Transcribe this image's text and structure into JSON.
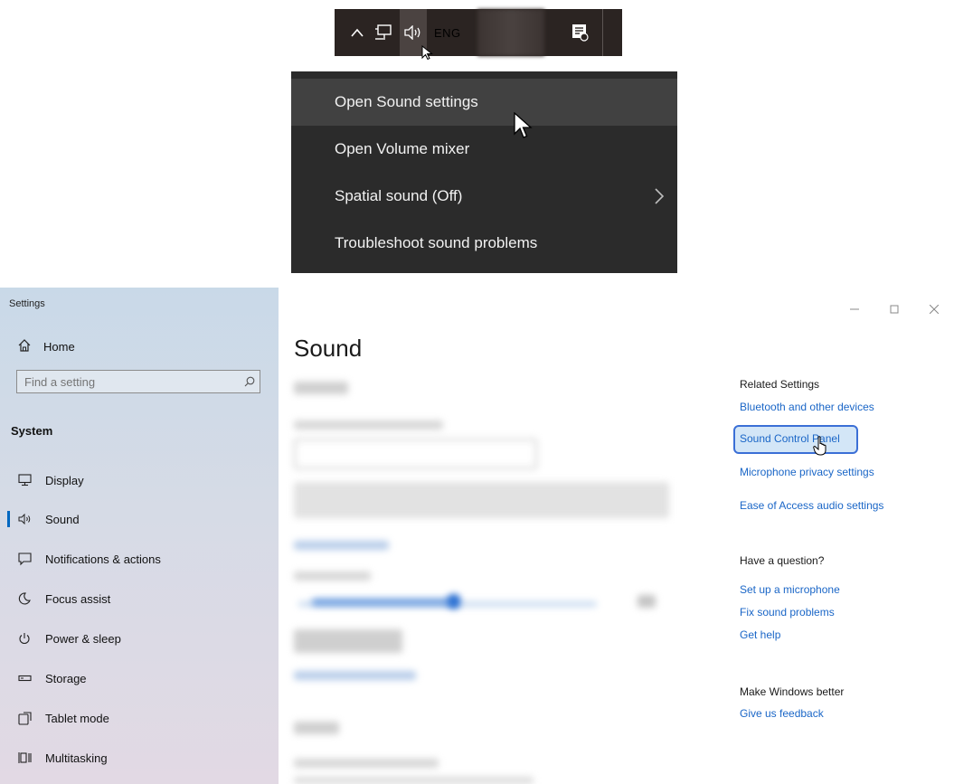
{
  "taskbar": {
    "language": "ENG",
    "icons": [
      "chevron-up-icon",
      "network-icon",
      "volume-icon",
      "notification-icon"
    ]
  },
  "context_menu": {
    "items": [
      {
        "label": "Open Sound settings",
        "hovered": true
      },
      {
        "label": "Open Volume mixer"
      },
      {
        "label": "Spatial sound (Off)",
        "has_submenu": true
      },
      {
        "label": "Troubleshoot sound problems"
      }
    ]
  },
  "settings": {
    "window_title": "Settings",
    "home_label": "Home",
    "search_placeholder": "Find a setting",
    "section_label": "System",
    "nav_items": [
      {
        "label": "Display",
        "icon": "display-icon"
      },
      {
        "label": "Sound",
        "icon": "sound-icon",
        "active": true
      },
      {
        "label": "Notifications & actions",
        "icon": "notifications-icon"
      },
      {
        "label": "Focus assist",
        "icon": "focus-assist-icon"
      },
      {
        "label": "Power & sleep",
        "icon": "power-icon"
      },
      {
        "label": "Storage",
        "icon": "storage-icon"
      },
      {
        "label": "Tablet mode",
        "icon": "tablet-icon"
      },
      {
        "label": "Multitasking",
        "icon": "multitasking-icon"
      }
    ],
    "page_title": "Sound",
    "related_settings": {
      "heading": "Related Settings",
      "links": [
        "Bluetooth and other devices",
        "Sound Control Panel",
        "Microphone privacy settings",
        "Ease of Access audio settings"
      ]
    },
    "question": {
      "heading": "Have a question?",
      "links": [
        "Set up a microphone",
        "Fix sound problems",
        "Get help"
      ]
    },
    "feedback": {
      "heading": "Make Windows better",
      "link": "Give us feedback"
    }
  },
  "colors": {
    "link": "#1a66c7",
    "accent": "#0067c0",
    "menu_bg": "#2b2b2b",
    "taskbar_bg": "#2b2422"
  }
}
